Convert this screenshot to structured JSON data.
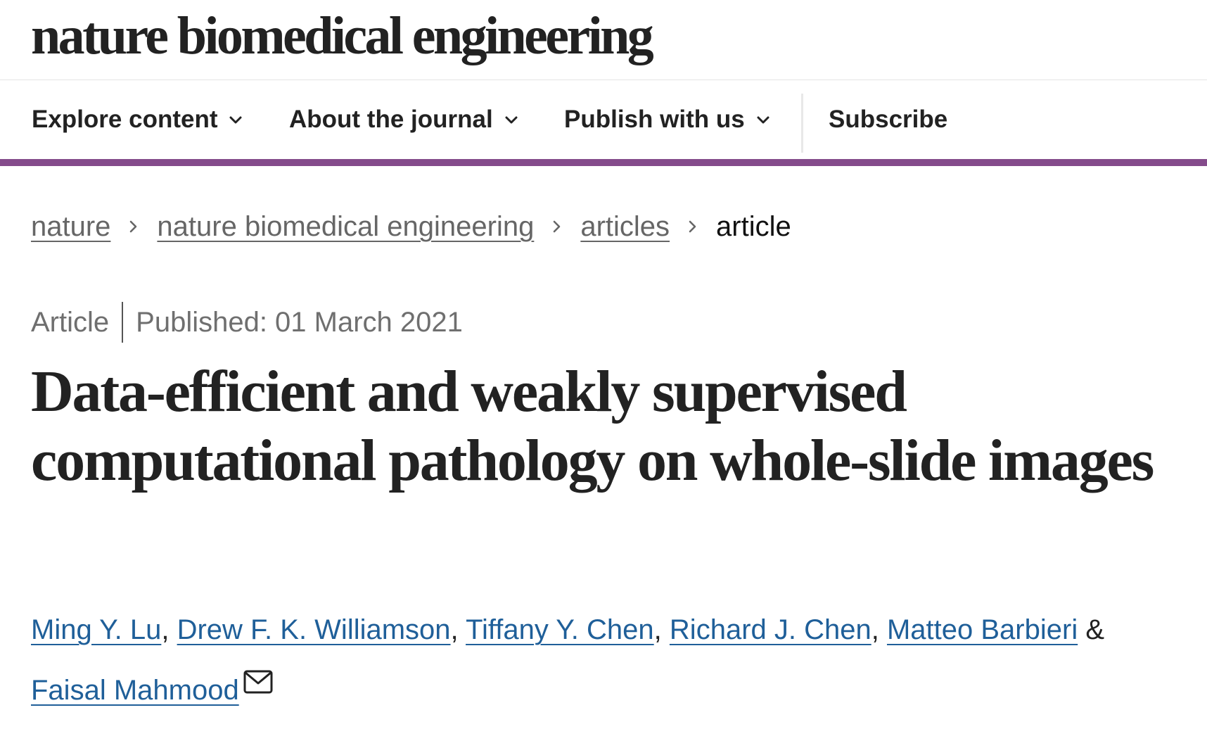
{
  "masthead": {
    "logo_text": "nature biomedical engineering"
  },
  "nav": {
    "items": [
      {
        "label": "Explore content",
        "has_dropdown": true,
        "icon": "chevron-down-icon"
      },
      {
        "label": "About the journal",
        "has_dropdown": true,
        "icon": "chevron-down-icon"
      },
      {
        "label": "Publish with us",
        "has_dropdown": true,
        "icon": "chevron-down-icon"
      },
      {
        "label": "Subscribe",
        "has_dropdown": false
      }
    ],
    "accent_color": "#844b8b"
  },
  "breadcrumb": {
    "items": [
      {
        "label": "nature"
      },
      {
        "label": "nature biomedical engineering"
      },
      {
        "label": "articles"
      }
    ],
    "current": "article",
    "separator_icon": "chevron-right-icon"
  },
  "article": {
    "type": "Article",
    "published": "Published: 01 March 2021",
    "title": "Data-efficient and weakly supervised computational pathology on whole-slide images",
    "authors": [
      {
        "name": "Ming Y. Lu"
      },
      {
        "name": "Drew F. K. Williamson"
      },
      {
        "name": "Tiffany Y. Chen"
      },
      {
        "name": "Richard J. Chen"
      },
      {
        "name": "Matteo Barbieri"
      },
      {
        "name": "Faisal Mahmood",
        "corresponding": true,
        "icon": "envelope-icon"
      }
    ],
    "author_separator": ",",
    "author_last_join": "&",
    "link_color": "#1f5f99"
  }
}
